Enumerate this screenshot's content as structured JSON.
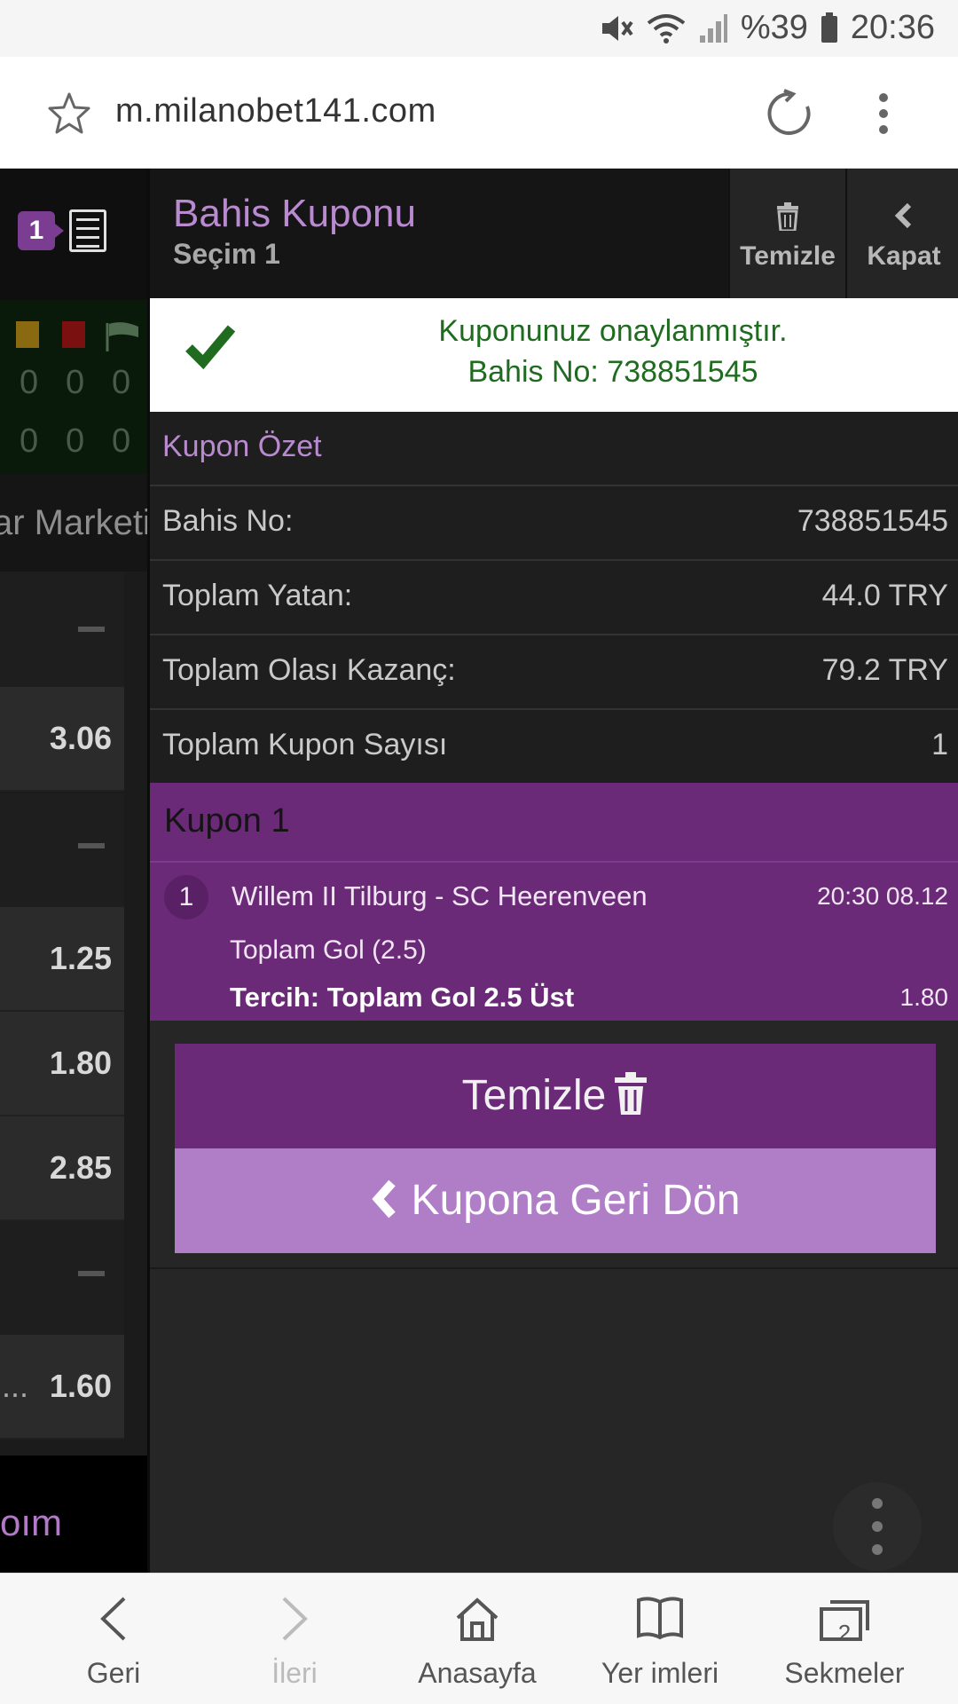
{
  "status_bar": {
    "battery": "%39",
    "time": "20:36"
  },
  "browser": {
    "url": "m.milanobet141.com"
  },
  "background_page": {
    "badge_count": "1",
    "scores_row1": [
      "0",
      "0",
      "0"
    ],
    "scores_row2": [
      "0",
      "0",
      "0"
    ],
    "market_text": "ar Marketi",
    "odds": [
      "3.06",
      "1.25",
      "1.80",
      "2.85",
      "1.60"
    ],
    "ellipsis": "...",
    "bottom_text": "oım"
  },
  "coupon_panel": {
    "title": "Bahis Kuponu",
    "subtitle": "Seçim 1",
    "clear_label": "Temizle",
    "close_label": "Kapat",
    "confirmation": {
      "line1": "Kuponunuz onaylanmıştır.",
      "line2": "Bahis No: 738851545"
    },
    "summary_title": "Kupon Özet",
    "summary": [
      {
        "label": "Bahis No:",
        "value": "738851545"
      },
      {
        "label": "Toplam Yatan:",
        "value": "44.0 TRY"
      },
      {
        "label": "Toplam Olası Kazanç:",
        "value": "79.2 TRY"
      },
      {
        "label": "Toplam Kupon Sayısı",
        "value": "1"
      }
    ],
    "kupon": {
      "title": "Kupon 1",
      "index": "1",
      "match": "Willem II Tilburg - SC Heerenveen",
      "datetime": "20:30 08.12",
      "market": "Toplam Gol (2.5)",
      "pick": "Tercih: Toplam Gol 2.5 Üst",
      "odd": "1.80"
    },
    "clear_button": "Temizle",
    "back_button": "Kupona Geri Dön"
  },
  "bottom_nav": {
    "back": "Geri",
    "forward": "İleri",
    "home": "Anasayfa",
    "bookmarks": "Yer imleri",
    "tabs": "Sekmeler",
    "tab_count": "2"
  },
  "colors": {
    "purple_dark": "#6a2a78",
    "purple_light": "#b07ec6",
    "title_purple": "#b98ad0",
    "confirm_green": "#1f6b1f"
  }
}
